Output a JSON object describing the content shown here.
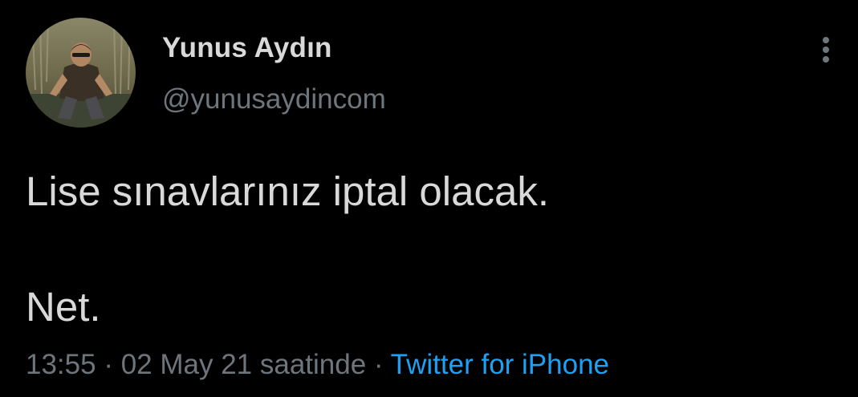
{
  "user": {
    "display_name": "Yunus Aydın",
    "handle": "@yunusaydincom",
    "avatar_icon": "profile-photo-icon"
  },
  "menu": {
    "icon": "more-vertical-icon"
  },
  "tweet": {
    "line1": "Lise sınavlarınız iptal olacak.",
    "line2": "Net."
  },
  "meta": {
    "time": "13:55",
    "separator1": " · ",
    "date": "02 May 21 saatinde",
    "separator2": " · ",
    "source": "Twitter for iPhone"
  },
  "colors": {
    "background": "#000000",
    "text": "#d9d9d9",
    "secondary": "#6e767d",
    "link": "#1da1f2"
  }
}
